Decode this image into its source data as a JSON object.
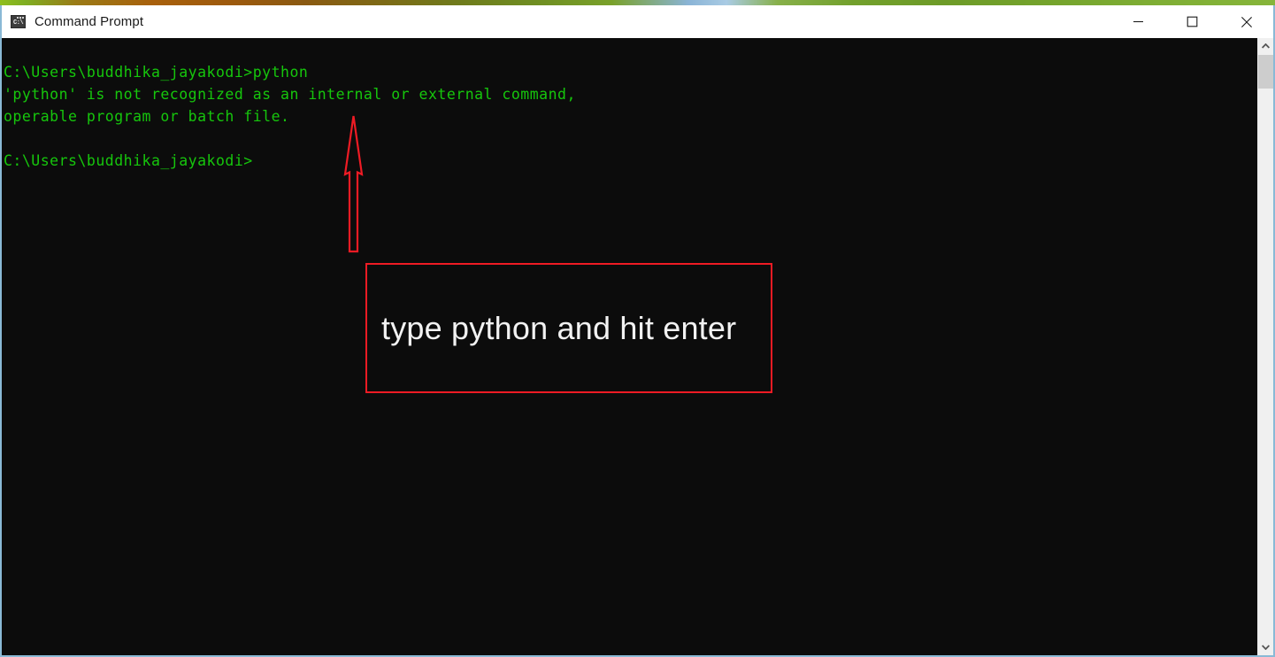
{
  "window": {
    "title": "Command Prompt",
    "icon": "command-prompt-icon",
    "icon_glyph": "C:\\",
    "controls": {
      "minimize": "minimize-icon",
      "maximize": "maximize-icon",
      "close": "close-icon"
    },
    "border_color": "#8ab9d6"
  },
  "terminal": {
    "background": "#0c0c0c",
    "text_color": "#16c60c",
    "lines": [
      "C:\\Users\\buddhika_jayakodi>python",
      "'python' is not recognized as an internal or external command,",
      "operable program or batch file.",
      "",
      "C:\\Users\\buddhika_jayakodi>"
    ],
    "content": "C:\\Users\\buddhika_jayakodi>python\n'python' is not recognized as an internal or external command,\noperable program or batch file.\n\nC:\\Users\\buddhika_jayakodi>"
  },
  "annotations": {
    "accent_color": "#ee1b24",
    "arrow": {
      "name": "upward-arrow",
      "direction": "up",
      "points_to": "python command on first line"
    },
    "callout": {
      "text": "type python and hit enter",
      "text_color": "#f2f2f2"
    }
  },
  "scrollbar": {
    "up_arrow": "chevron-up-icon",
    "down_arrow": "chevron-down-icon",
    "thumb": "scrollbar-thumb"
  }
}
